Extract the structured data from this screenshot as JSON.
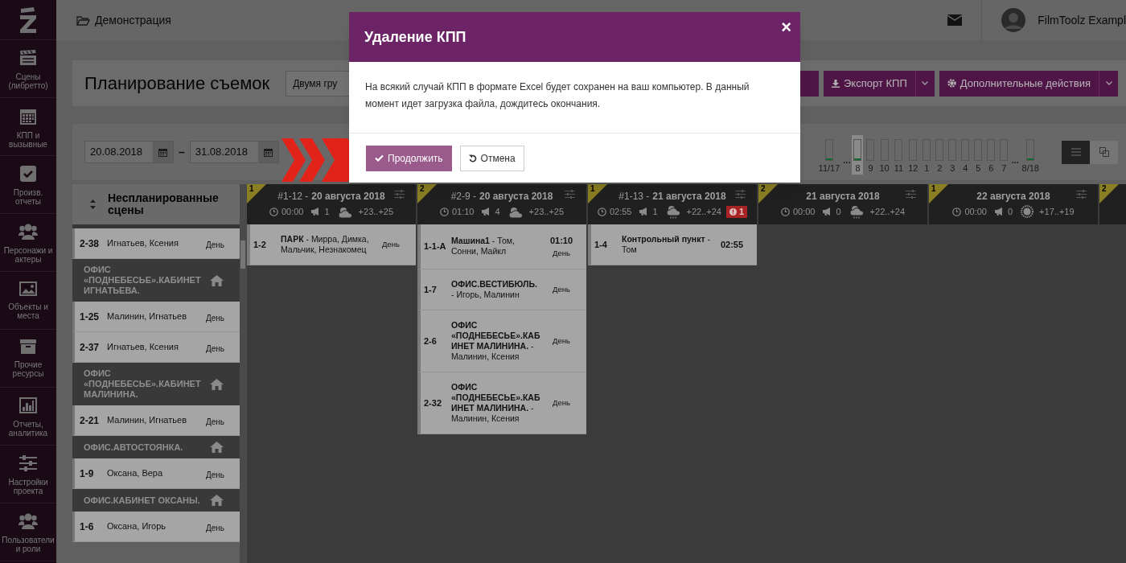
{
  "sidebar": {
    "items": [
      {
        "label": "Сцены (либретто)"
      },
      {
        "label": "КПП и вызывные"
      },
      {
        "label": "Произв. отчеты"
      },
      {
        "label": "Персонажи и актеры"
      },
      {
        "label": "Объекты и места"
      },
      {
        "label": "Прочие ресурсы"
      },
      {
        "label": "Отчеты, аналитика"
      },
      {
        "label": "Настройки проекта"
      },
      {
        "label": "Пользователи и роли"
      }
    ]
  },
  "header": {
    "project": "Демонстрация",
    "user": "FilmToolz Exampl"
  },
  "page": {
    "title": "Планирование съемок",
    "grouping": "Двумя гру",
    "buttons": [
      {
        "label": "Экспорт КПП"
      },
      {
        "label": "Дополнительные действия"
      }
    ]
  },
  "dates": {
    "from": "20.08.2018",
    "separator": "–",
    "to": "31.08.2018"
  },
  "timeline": [
    {
      "kind": "bar",
      "label": "11/17",
      "level": 0.07,
      "selected": false
    },
    {
      "kind": "gap",
      "label": "..."
    },
    {
      "kind": "bar",
      "label": "8",
      "level": 0.07,
      "selected": true
    },
    {
      "kind": "bar",
      "label": "9",
      "selected": false
    },
    {
      "kind": "bar",
      "label": "10",
      "selected": false
    },
    {
      "kind": "bar",
      "label": "11",
      "selected": false
    },
    {
      "kind": "bar",
      "label": "12",
      "selected": false
    },
    {
      "kind": "bar",
      "label": "1",
      "selected": false
    },
    {
      "kind": "bar",
      "label": "2",
      "selected": false
    },
    {
      "kind": "bar",
      "label": "3",
      "selected": false
    },
    {
      "kind": "bar",
      "label": "4",
      "selected": false
    },
    {
      "kind": "bar",
      "label": "5",
      "selected": false
    },
    {
      "kind": "bar",
      "label": "6",
      "selected": false
    },
    {
      "kind": "bar",
      "label": "7",
      "selected": false
    },
    {
      "kind": "gap",
      "label": "..."
    },
    {
      "kind": "bar",
      "label": "8/18",
      "level": 0.07,
      "selected": false
    }
  ],
  "views": [
    {
      "kind": "list",
      "selected": true
    },
    {
      "kind": "cascade",
      "selected": false
    }
  ],
  "unplanned": {
    "title": "Неспланированные сцены",
    "items": [
      {
        "kind": "scene",
        "number": "2-38",
        "cast": "Игнатьев, Ксения",
        "daytime": "День"
      },
      {
        "kind": "location",
        "name": "ОФИС «ПОДНЕБЕСЬЕ».КАБИНЕТ ИГНАТЬЕВА."
      },
      {
        "kind": "scene",
        "number": "1-25",
        "cast": "Малинин, Игнатьев",
        "daytime": "День"
      },
      {
        "kind": "scene",
        "number": "2-37",
        "cast": "Игнатьев, Ксения",
        "daytime": "День"
      },
      {
        "kind": "location",
        "name": "ОФИС «ПОДНЕБЕСЬЕ».КАБИНЕТ МАЛИНИНА."
      },
      {
        "kind": "scene",
        "number": "2-21",
        "cast": "Малинин, Игнатьев",
        "daytime": "День"
      },
      {
        "kind": "location",
        "name": "ОФИС.АВТОСТОЯНКА."
      },
      {
        "kind": "scene",
        "number": "1-9",
        "cast": "Оксана, Вера",
        "daytime": "День"
      },
      {
        "kind": "location",
        "name": "ОФИС.КАБИНЕТ ОКСАНЫ."
      },
      {
        "kind": "scene",
        "number": "1-6",
        "cast": "Оксана, Игорь",
        "daytime": "День"
      }
    ]
  },
  "days": [
    {
      "badge": "1",
      "prefix": "#1-12 -",
      "date": "20 августа 2018",
      "time": "00:00",
      "calls": "1",
      "weather": {
        "kind": "partly-cloudy",
        "temperature": "+23..+25"
      },
      "cards": [
        {
          "number": "1-2",
          "text": "**ПАРК** - Мирра, Димка, Мальчик, Незнакомец",
          "daytime": "День"
        }
      ]
    },
    {
      "badge": "2",
      "prefix": "#2-9 -",
      "date": "20 августа 2018",
      "time": "01:10",
      "calls": "4",
      "weather": {
        "kind": "partly-cloudy",
        "temperature": "+23..+25"
      },
      "cards": [
        {
          "number": "1-1-А",
          "text": "**Машина1** - Том, Сонни, Майкл",
          "time": "01:10",
          "daytime": "День"
        },
        {
          "number": "1-7",
          "text": "**ОФИС.ВЕСТИБЮЛЬ.** - Игорь, Малинин",
          "daytime": "День"
        },
        {
          "number": "2-6",
          "text": "**ОФИС «ПОДНЕБЕСЬЕ».КАБИНЕТ МАЛИНИНА.** - Малинин, Ксения",
          "daytime": "День"
        },
        {
          "number": "2-32",
          "text": "**ОФИС «ПОДНЕБЕСЬЕ».КАБИНЕТ МАЛИНИНА.** - Малинин, Ксения",
          "daytime": "День"
        }
      ]
    },
    {
      "badge": "1",
      "prefix": "#1-13 -",
      "date": "21 августа 2018",
      "time": "02:55",
      "calls": "1",
      "weather": {
        "kind": "rain",
        "temperature": "+22..+24"
      },
      "alert": "1",
      "cards": [
        {
          "number": "1-4",
          "text": "**Контрольный пункт** - Том",
          "time": "02:55"
        }
      ]
    },
    {
      "badge": "2",
      "date": "21 августа 2018",
      "time": "00:00",
      "calls": "0",
      "weather": {
        "kind": "rain",
        "temperature": "+22..+24"
      }
    },
    {
      "badge": "1",
      "date": "22 августа 2018",
      "time": "00:00",
      "calls": "0",
      "weather": {
        "kind": "sun",
        "temperature": "+17..+19"
      }
    },
    {
      "badge": "2"
    }
  ],
  "dialog": {
    "title": "Удаление КПП",
    "close": "×",
    "message": "На всякий случай КПП в формате Excel будет сохранен на ваш компьютер. В данный момент идет загрузка файла, дождитесь окончания.",
    "confirm": "Продолжить",
    "cancel": "Отмена"
  }
}
